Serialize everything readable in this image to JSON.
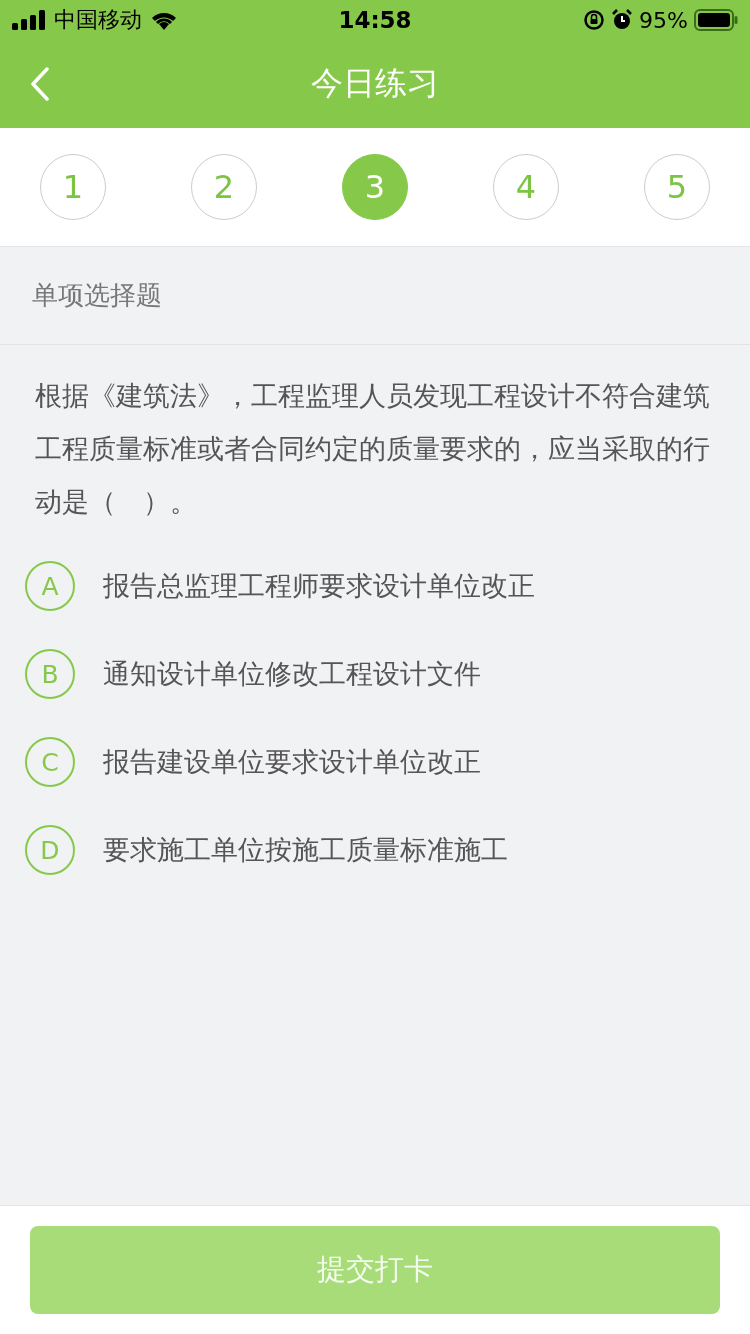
{
  "status_bar": {
    "carrier": "中国移动",
    "time": "14:58",
    "battery": "95%"
  },
  "nav": {
    "title": "今日练习"
  },
  "steps": [
    {
      "label": "1",
      "selected": false
    },
    {
      "label": "2",
      "selected": false
    },
    {
      "label": "3",
      "selected": true
    },
    {
      "label": "4",
      "selected": false
    },
    {
      "label": "5",
      "selected": false
    }
  ],
  "section_title": "单项选择题",
  "question": "根据《建筑法》，工程监理人员发现工程设计不符合建筑工程质量标准或者合同约定的质量要求的，应当采取的行动是（　）。",
  "options": [
    {
      "letter": "A",
      "text": "报告总监理工程师要求设计单位改正",
      "selected": false
    },
    {
      "letter": "B",
      "text": "通知设计单位修改工程设计文件",
      "selected": false
    },
    {
      "letter": "C",
      "text": "报告建设单位要求设计单位改正",
      "selected": false
    },
    {
      "letter": "D",
      "text": "要求施工单位按施工质量标准施工",
      "selected": false
    }
  ],
  "submit": {
    "label": "提交打卡",
    "disabled": true
  }
}
